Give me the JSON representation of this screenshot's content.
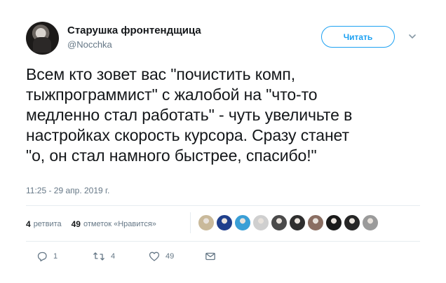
{
  "author": {
    "name": "Старушка фронтендщица",
    "handle": "@Nocchka"
  },
  "follow_button": {
    "label": "Читать"
  },
  "tweet": {
    "text": "Всем кто зовет вас \"почистить комп,\nтыжпрограммист\" с жалобой на \"что-то\nмедленно стал работать\" - чуть увеличьте в\nнастройках скорость курсора. Сразу станет\n\"о, он стал намного быстрее, спасибо!\"",
    "timestamp": "11:25 - 29 апр. 2019 г."
  },
  "stats": {
    "retweets_count": "4",
    "retweets_label": "ретвита",
    "likes_count": "49",
    "likes_label": "отметок «Нравится»"
  },
  "likers": [
    {
      "color": "#c9b99a"
    },
    {
      "color": "#1f3f8c"
    },
    {
      "color": "#3a9fd6"
    },
    {
      "color": "#cfcfcf"
    },
    {
      "color": "#4a4a4a"
    },
    {
      "color": "#2e2e2e"
    },
    {
      "color": "#8a6e62"
    },
    {
      "color": "#1a1a1a"
    },
    {
      "color": "#262626"
    },
    {
      "color": "#9a9a9a"
    }
  ],
  "actions": {
    "reply_count": "1",
    "retweet_count": "4",
    "like_count": "49"
  },
  "colors": {
    "accent": "#1da1f2",
    "secondary_text": "#657786",
    "divider": "#e6ecf0"
  },
  "icons": [
    "caret-down-icon",
    "reply-icon",
    "retweet-icon",
    "like-icon",
    "message-icon"
  ]
}
